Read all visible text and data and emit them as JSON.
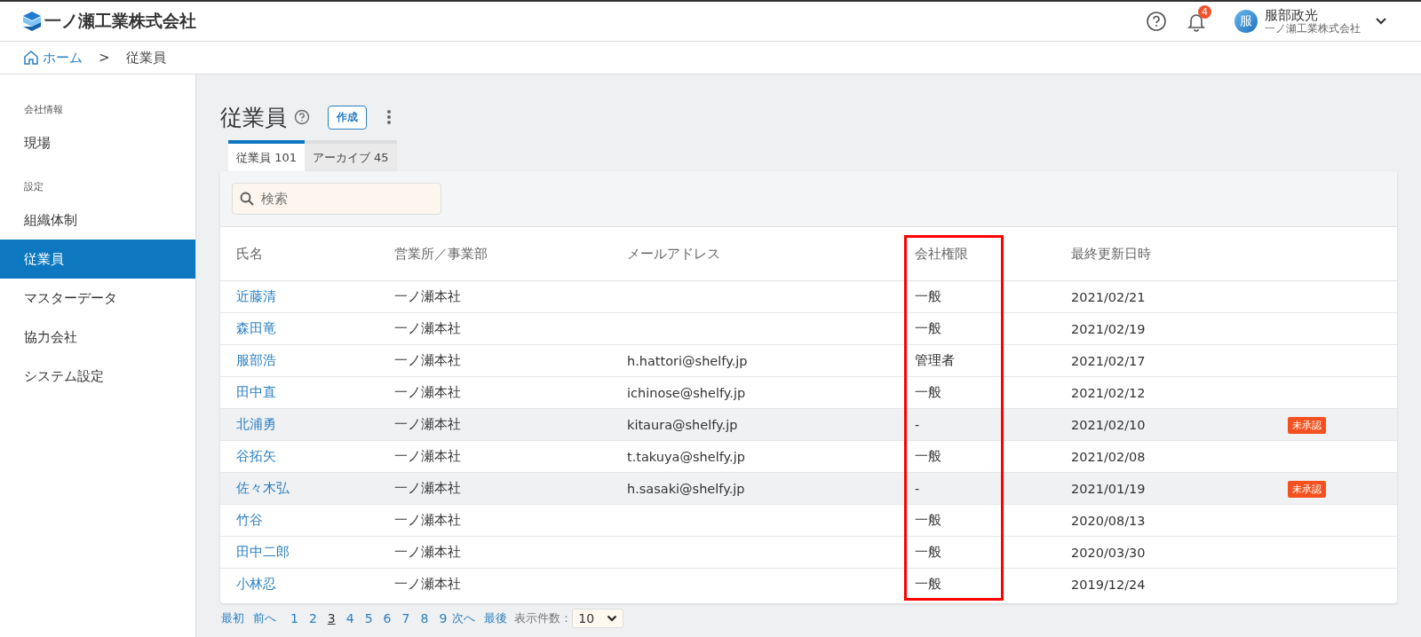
{
  "header": {
    "company": "一ノ瀬工業株式会社",
    "notifications": "4",
    "user": {
      "avatar": "服",
      "name": "服部政光",
      "company": "一ノ瀬工業株式会社"
    }
  },
  "breadcrumb": {
    "home": "ホーム",
    "separator": ">",
    "current": "従業員"
  },
  "sidebar": {
    "sections": [
      {
        "heading": "会社情報",
        "items": [
          {
            "label": "現場",
            "selected": false
          }
        ]
      },
      {
        "heading": "設定",
        "items": [
          {
            "label": "組織体制",
            "selected": false
          },
          {
            "label": "従業員",
            "selected": true
          },
          {
            "label": "マスターデータ",
            "selected": false
          },
          {
            "label": "協力会社",
            "selected": false
          },
          {
            "label": "システム設定",
            "selected": false
          }
        ]
      }
    ]
  },
  "page": {
    "title": "従業員",
    "create_button": "作成"
  },
  "tabs": [
    {
      "label": "従業員 101",
      "selected": true
    },
    {
      "label": "アーカイブ 45",
      "selected": false
    }
  ],
  "search": {
    "placeholder": "検索"
  },
  "table": {
    "columns": [
      {
        "label": "氏名",
        "highlighted": false
      },
      {
        "label": "営業所／事業部",
        "highlighted": false
      },
      {
        "label": "メールアドレス",
        "highlighted": false
      },
      {
        "label": "会社権限",
        "highlighted": true
      },
      {
        "label": "最終更新日時",
        "highlighted": false
      }
    ],
    "rows": [
      {
        "name": "近藤清",
        "office": "一ノ瀬本社",
        "email": "",
        "role": "一般",
        "updated": "2021/02/21",
        "badge": ""
      },
      {
        "name": "森田竜",
        "office": "一ノ瀬本社",
        "email": "",
        "role": "一般",
        "updated": "2021/02/19",
        "badge": ""
      },
      {
        "name": "服部浩",
        "office": "一ノ瀬本社",
        "email": "h.hattori@shelfy.jp",
        "role": "管理者",
        "updated": "2021/02/17",
        "badge": ""
      },
      {
        "name": "田中直",
        "office": "一ノ瀬本社",
        "email": "ichinose@shelfy.jp",
        "role": "一般",
        "updated": "2021/02/12",
        "badge": ""
      },
      {
        "name": "北浦勇",
        "office": "一ノ瀬本社",
        "email": "kitaura@shelfy.jp",
        "role": "-",
        "updated": "2021/02/10",
        "badge": "未承認"
      },
      {
        "name": "谷拓矢",
        "office": "一ノ瀬本社",
        "email": "t.takuya@shelfy.jp",
        "role": "一般",
        "updated": "2021/02/08",
        "badge": ""
      },
      {
        "name": "佐々木弘",
        "office": "一ノ瀬本社",
        "email": "h.sasaki@shelfy.jp",
        "role": "-",
        "updated": "2021/01/19",
        "badge": "未承認"
      },
      {
        "name": "竹谷",
        "office": "一ノ瀬本社",
        "email": "",
        "role": "一般",
        "updated": "2020/08/13",
        "badge": ""
      },
      {
        "name": "田中二郎",
        "office": "一ノ瀬本社",
        "email": "",
        "role": "一般",
        "updated": "2020/03/30",
        "badge": ""
      },
      {
        "name": "小林忍",
        "office": "一ノ瀬本社",
        "email": "",
        "role": "一般",
        "updated": "2019/12/24",
        "badge": ""
      }
    ]
  },
  "pagination": {
    "first": "最初",
    "prev": "前へ",
    "pages": [
      {
        "label": "1",
        "selected": false
      },
      {
        "label": "2",
        "selected": false
      },
      {
        "label": "3",
        "selected": true
      },
      {
        "label": "4",
        "selected": false
      },
      {
        "label": "5",
        "selected": false
      },
      {
        "label": "6",
        "selected": false
      },
      {
        "label": "7",
        "selected": false
      },
      {
        "label": "8",
        "selected": false
      },
      {
        "label": "9",
        "selected": false
      }
    ],
    "next": "次へ",
    "last": "最後",
    "per_page_label": "表示件数：",
    "per_page": "10"
  }
}
